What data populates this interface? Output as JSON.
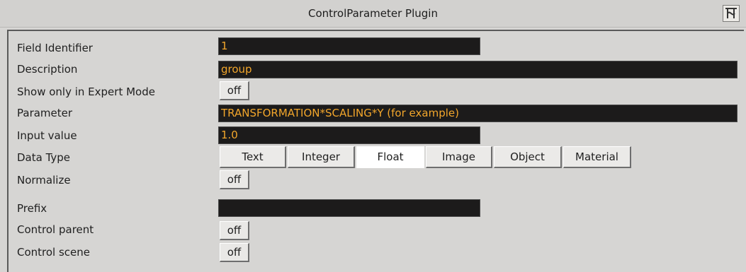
{
  "window": {
    "title": "ControlParameter Plugin",
    "corner_icon": "vizrt-logo-icon"
  },
  "fields": {
    "field_identifier": {
      "label": "Field Identifier",
      "value": "1"
    },
    "description": {
      "label": "Description",
      "value": "group"
    },
    "expert_mode": {
      "label": "Show only in Expert Mode",
      "value": "off"
    },
    "parameter": {
      "label": "Parameter",
      "value": "TRANSFORMATION*SCALING*Y (for example)"
    },
    "input_value": {
      "label": "Input value",
      "value": "1.0"
    },
    "data_type": {
      "label": "Data Type",
      "options": [
        "Text",
        "Integer",
        "Float",
        "Image",
        "Object",
        "Material"
      ],
      "selected": "Float"
    },
    "normalize": {
      "label": "Normalize",
      "value": "off"
    },
    "prefix": {
      "label": "Prefix",
      "value": ""
    },
    "control_parent": {
      "label": "Control parent",
      "value": "off"
    },
    "control_scene": {
      "label": "Control scene",
      "value": "off"
    }
  }
}
